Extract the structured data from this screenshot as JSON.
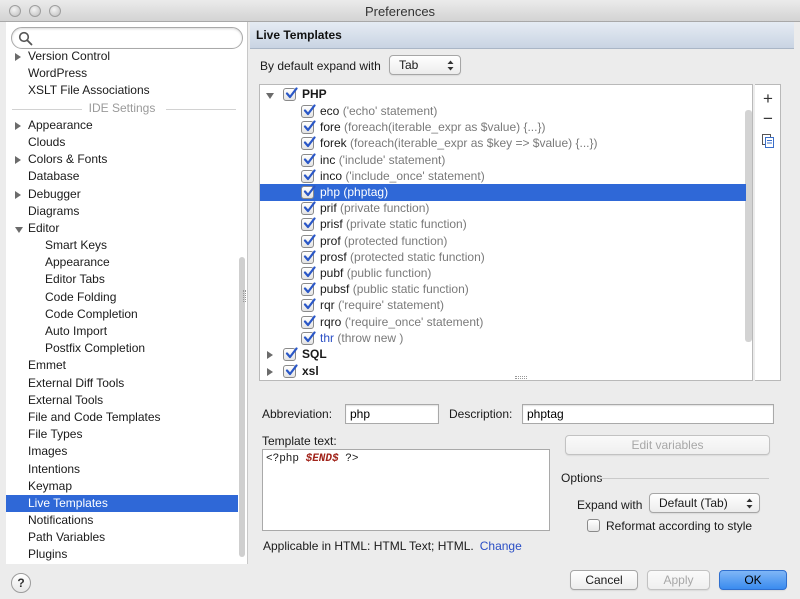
{
  "window": {
    "title": "Preferences"
  },
  "search": {
    "placeholder": "",
    "value": ""
  },
  "sidebar": {
    "items": [
      {
        "label": "Version Control",
        "arrow": "right",
        "indent": 0
      },
      {
        "label": "WordPress",
        "arrow": "none",
        "indent": 0
      },
      {
        "label": "XSLT File Associations",
        "arrow": "none",
        "indent": 0
      },
      {
        "label": "IDE Settings",
        "type": "section"
      },
      {
        "label": "Appearance",
        "arrow": "right",
        "indent": 0
      },
      {
        "label": "Clouds",
        "arrow": "none",
        "indent": 0
      },
      {
        "label": "Colors & Fonts",
        "arrow": "right",
        "indent": 0
      },
      {
        "label": "Database",
        "arrow": "none",
        "indent": 0
      },
      {
        "label": "Debugger",
        "arrow": "right",
        "indent": 0
      },
      {
        "label": "Diagrams",
        "arrow": "none",
        "indent": 0
      },
      {
        "label": "Editor",
        "arrow": "down",
        "indent": 0
      },
      {
        "label": "Smart Keys",
        "arrow": "none",
        "indent": 1
      },
      {
        "label": "Appearance",
        "arrow": "none",
        "indent": 1
      },
      {
        "label": "Editor Tabs",
        "arrow": "none",
        "indent": 1
      },
      {
        "label": "Code Folding",
        "arrow": "none",
        "indent": 1
      },
      {
        "label": "Code Completion",
        "arrow": "none",
        "indent": 1
      },
      {
        "label": "Auto Import",
        "arrow": "none",
        "indent": 1
      },
      {
        "label": "Postfix Completion",
        "arrow": "none",
        "indent": 1
      },
      {
        "label": "Emmet",
        "arrow": "none",
        "indent": 0
      },
      {
        "label": "External Diff Tools",
        "arrow": "none",
        "indent": 0
      },
      {
        "label": "External Tools",
        "arrow": "none",
        "indent": 0
      },
      {
        "label": "File and Code Templates",
        "arrow": "none",
        "indent": 0
      },
      {
        "label": "File Types",
        "arrow": "none",
        "indent": 0
      },
      {
        "label": "Images",
        "arrow": "none",
        "indent": 0
      },
      {
        "label": "Intentions",
        "arrow": "none",
        "indent": 0
      },
      {
        "label": "Keymap",
        "arrow": "none",
        "indent": 0
      },
      {
        "label": "Live Templates",
        "arrow": "none",
        "indent": 0,
        "selected": true
      },
      {
        "label": "Notifications",
        "arrow": "none",
        "indent": 0
      },
      {
        "label": "Path Variables",
        "arrow": "none",
        "indent": 0
      },
      {
        "label": "Plugins",
        "arrow": "none",
        "indent": 0
      }
    ]
  },
  "panel": {
    "title": "Live Templates",
    "expand_label": "By default expand with",
    "expand_value": "Tab"
  },
  "templates": {
    "groups": [
      {
        "name": "PHP",
        "expanded": true,
        "checked": true,
        "items": [
          {
            "abbr": "eco",
            "desc": "('echo' statement)"
          },
          {
            "abbr": "fore",
            "desc": "(foreach(iterable_expr as $value) {...})"
          },
          {
            "abbr": "forek",
            "desc": "(foreach(iterable_expr as $key => $value) {...})"
          },
          {
            "abbr": "inc",
            "desc": "('include' statement)"
          },
          {
            "abbr": "inco",
            "desc": "('include_once' statement)"
          },
          {
            "abbr": "php",
            "desc": "(phptag)",
            "selected": true
          },
          {
            "abbr": "prif",
            "desc": "(private function)"
          },
          {
            "abbr": "prisf",
            "desc": "(private static function)"
          },
          {
            "abbr": "prof",
            "desc": "(protected function)"
          },
          {
            "abbr": "prosf",
            "desc": "(protected static function)"
          },
          {
            "abbr": "pubf",
            "desc": "(public function)"
          },
          {
            "abbr": "pubsf",
            "desc": "(public static function)"
          },
          {
            "abbr": "rqr",
            "desc": "('require' statement)"
          },
          {
            "abbr": "rqro",
            "desc": "('require_once' statement)"
          },
          {
            "abbr": "thr",
            "desc": "(throw new )",
            "blue": true
          }
        ]
      },
      {
        "name": "SQL",
        "expanded": false,
        "checked": true,
        "items": []
      },
      {
        "name": "xsl",
        "expanded": false,
        "checked": true,
        "items": []
      }
    ]
  },
  "tools": {
    "add": "+",
    "remove": "−"
  },
  "form": {
    "abbreviation_label": "Abbreviation:",
    "abbreviation_value": "php",
    "description_label": "Description:",
    "description_value": "phptag",
    "template_text_label": "Template text:",
    "template_text_prefix": "<?php ",
    "template_text_var": "$END$",
    "template_text_suffix": " ?>",
    "edit_variables": "Edit variables",
    "options_label": "Options",
    "expand_with_label": "Expand with",
    "expand_with_value": "Default (Tab)",
    "reformat_label": "Reformat according to style",
    "reformat_checked": false,
    "applicable_text": "Applicable in HTML: HTML Text; HTML.",
    "change_link": "Change"
  },
  "footer": {
    "help": "?",
    "cancel": "Cancel",
    "apply": "Apply",
    "ok": "OK"
  },
  "colors": {
    "selection": "#2f68d7",
    "link": "#2a4ec5",
    "check": "#2a57c7"
  }
}
